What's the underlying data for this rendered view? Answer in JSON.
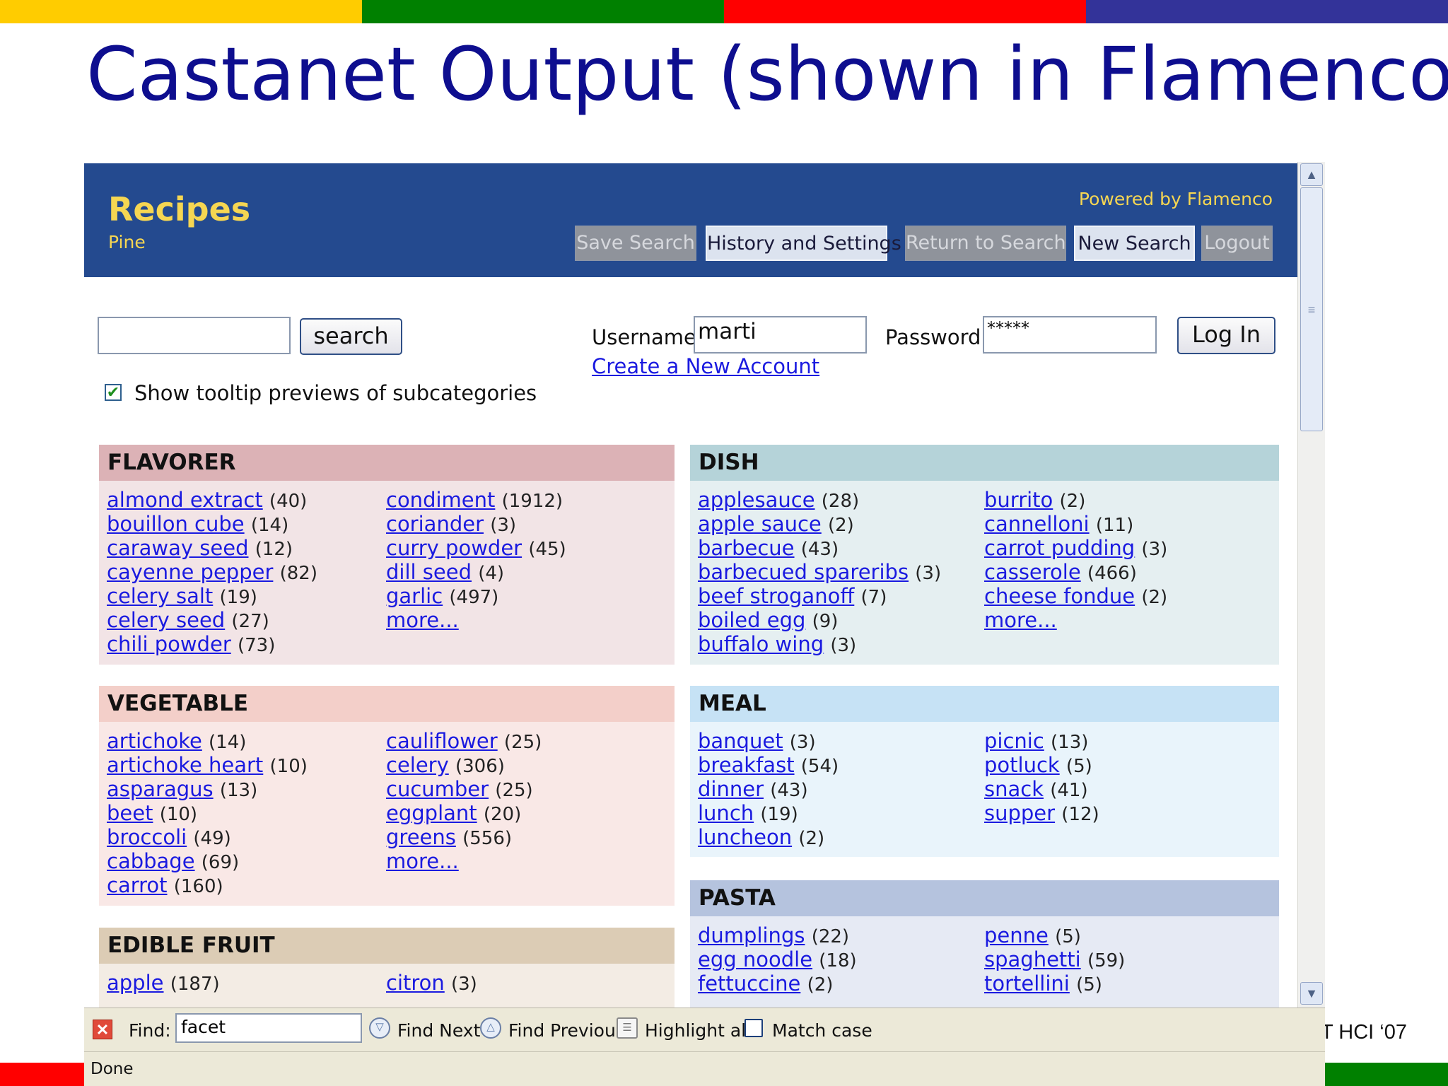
{
  "slide": {
    "title": "Castanet Output (shown in Flamenco)",
    "credit": "T HCI  ‘07",
    "colors": {
      "yellow": "#ffcc00",
      "green": "#008000",
      "red": "#ff0000",
      "blue": "#333399"
    }
  },
  "app": {
    "title": "Recipes",
    "subtitle": "Pine",
    "powered_by": "Powered by Flamenco",
    "buttons": {
      "save_search": "Save Search",
      "history": "History and Settings",
      "return_search": "Return to Search",
      "new_search": "New Search",
      "logout": "Logout"
    }
  },
  "search": {
    "value": "",
    "button_label": "search"
  },
  "login": {
    "username_label": "Username",
    "username_value": "marti",
    "password_label": "Password",
    "password_value": "*****",
    "login_button": "Log In",
    "create_account": "Create a New Account"
  },
  "tooltip_checkbox": {
    "label": "Show tooltip previews of subcategories",
    "checked": true
  },
  "facets": {
    "flavorer": {
      "title": "FLAVORER",
      "col1": [
        {
          "name": "almond  extract",
          "count": "(40)"
        },
        {
          "name": "bouillon  cube",
          "count": "(14)"
        },
        {
          "name": "caraway  seed",
          "count": "(12)"
        },
        {
          "name": "cayenne  pepper",
          "count": "(82)"
        },
        {
          "name": "celery  salt",
          "count": "(19)"
        },
        {
          "name": "celery  seed",
          "count": "(27)"
        },
        {
          "name": "chili  powder",
          "count": "(73)"
        }
      ],
      "col2": [
        {
          "name": "condiment",
          "count": "(1912)"
        },
        {
          "name": "coriander",
          "count": "(3)"
        },
        {
          "name": "curry  powder",
          "count": "(45)"
        },
        {
          "name": "dill  seed",
          "count": "(4)"
        },
        {
          "name": "garlic",
          "count": "(497)"
        },
        {
          "name": "more...",
          "count": ""
        }
      ]
    },
    "vegetable": {
      "title": "VEGETABLE",
      "col1": [
        {
          "name": "artichoke",
          "count": "(14)"
        },
        {
          "name": "artichoke  heart",
          "count": "(10)"
        },
        {
          "name": "asparagus",
          "count": "(13)"
        },
        {
          "name": "beet",
          "count": "(10)"
        },
        {
          "name": "broccoli",
          "count": "(49)"
        },
        {
          "name": "cabbage",
          "count": "(69)"
        },
        {
          "name": "carrot",
          "count": "(160)"
        }
      ],
      "col2": [
        {
          "name": "cauliflower",
          "count": "(25)"
        },
        {
          "name": "celery",
          "count": "(306)"
        },
        {
          "name": "cucumber",
          "count": "(25)"
        },
        {
          "name": "eggplant",
          "count": "(20)"
        },
        {
          "name": "greens",
          "count": "(556)"
        },
        {
          "name": "more...",
          "count": ""
        }
      ]
    },
    "edible_fruit": {
      "title": "EDIBLE FRUIT",
      "col1": [
        {
          "name": "apple",
          "count": "(187)"
        }
      ],
      "col2": [
        {
          "name": "citron",
          "count": "(3)"
        }
      ]
    },
    "dish": {
      "title": "DISH",
      "col1": [
        {
          "name": "applesauce",
          "count": "(28)"
        },
        {
          "name": "apple  sauce",
          "count": "(2)"
        },
        {
          "name": "barbecue",
          "count": "(43)"
        },
        {
          "name": "barbecued  spareribs",
          "count": "(3)"
        },
        {
          "name": "beef  stroganoff",
          "count": "(7)"
        },
        {
          "name": "boiled  egg",
          "count": "(9)"
        },
        {
          "name": "buffalo  wing",
          "count": "(3)"
        }
      ],
      "col2": [
        {
          "name": "burrito",
          "count": "(2)"
        },
        {
          "name": "cannelloni",
          "count": "(11)"
        },
        {
          "name": "carrot  pudding",
          "count": "(3)"
        },
        {
          "name": "casserole",
          "count": "(466)"
        },
        {
          "name": "cheese  fondue",
          "count": "(2)"
        },
        {
          "name": "more...",
          "count": ""
        }
      ]
    },
    "meal": {
      "title": "MEAL",
      "col1": [
        {
          "name": "banquet",
          "count": "(3)"
        },
        {
          "name": "breakfast",
          "count": "(54)"
        },
        {
          "name": "dinner",
          "count": "(43)"
        },
        {
          "name": "lunch",
          "count": "(19)"
        },
        {
          "name": "luncheon",
          "count": "(2)"
        }
      ],
      "col2": [
        {
          "name": "picnic",
          "count": "(13)"
        },
        {
          "name": "potluck",
          "count": "(5)"
        },
        {
          "name": "snack",
          "count": "(41)"
        },
        {
          "name": "supper",
          "count": "(12)"
        }
      ]
    },
    "pasta": {
      "title": "PASTA",
      "col1": [
        {
          "name": "dumplings",
          "count": "(22)"
        },
        {
          "name": "egg  noodle",
          "count": "(18)"
        },
        {
          "name": "fettuccine",
          "count": "(2)"
        }
      ],
      "col2": [
        {
          "name": "penne",
          "count": "(5)"
        },
        {
          "name": "spaghetti",
          "count": "(59)"
        },
        {
          "name": "tortellini",
          "count": "(5)"
        }
      ]
    }
  },
  "findbar": {
    "find_label": "Find:",
    "find_value": "facet",
    "find_next": "Find Next",
    "find_previous": "Find Previous",
    "highlight_all": "Highlight all",
    "match_case": "Match case"
  },
  "status": {
    "text": "Done"
  }
}
